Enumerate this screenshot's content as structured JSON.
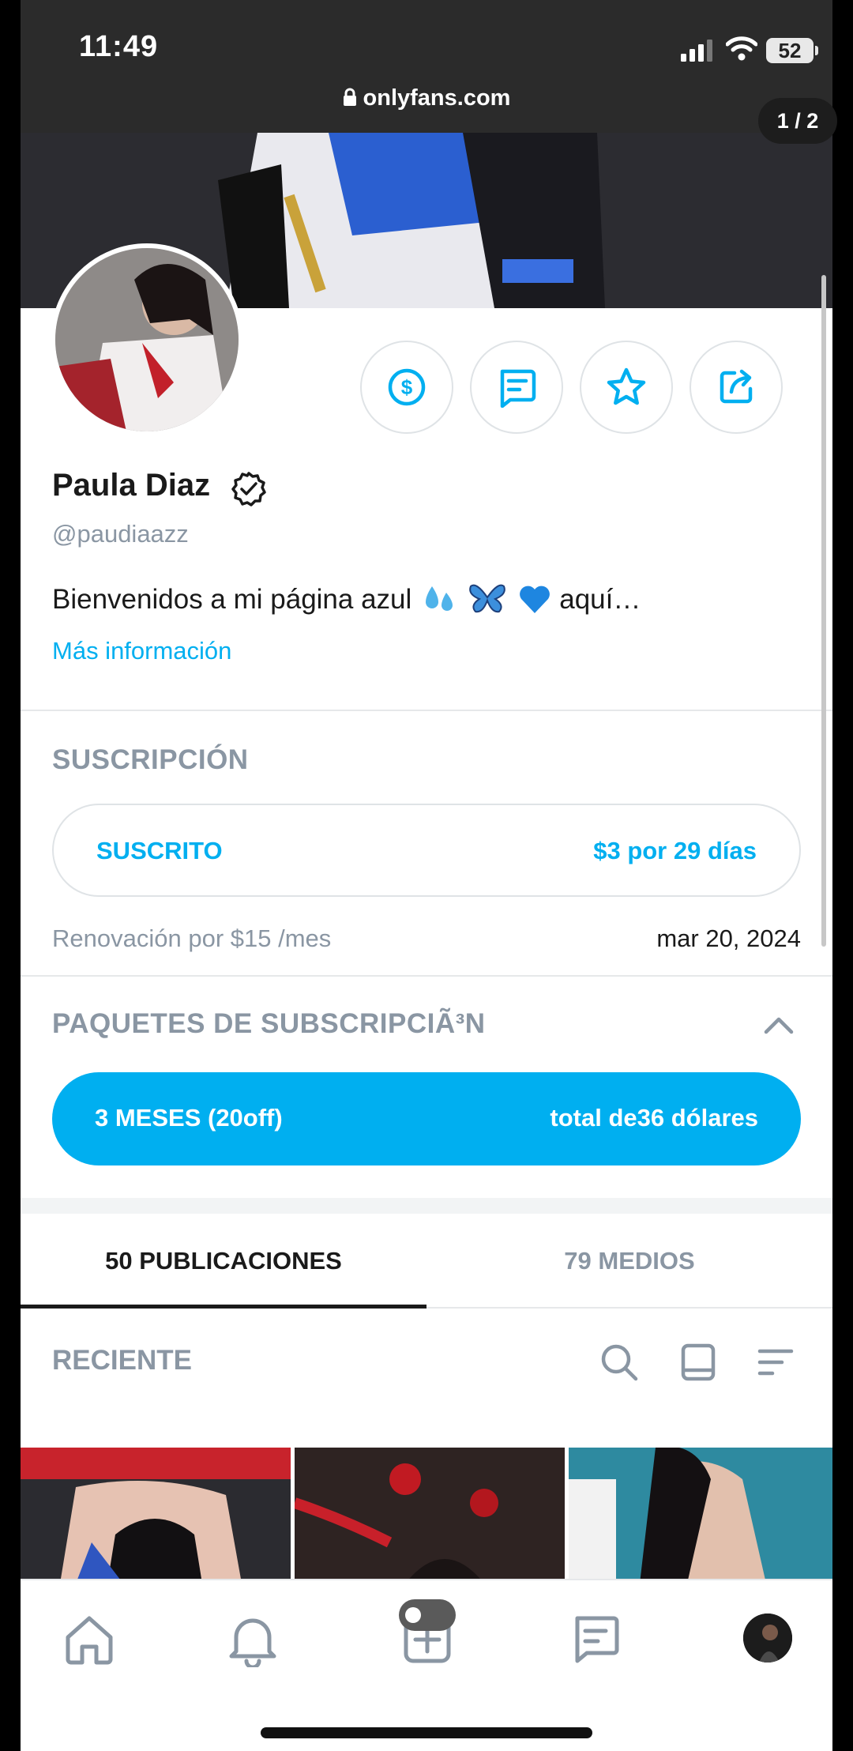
{
  "status_bar": {
    "time": "11:49",
    "battery": "52"
  },
  "browser": {
    "url": "onlyfans.com",
    "page_counter": "1 / 2"
  },
  "profile": {
    "name": "Paula Diaz",
    "handle": "@paudiaazz",
    "bio": "Bienvenidos a mi página azul",
    "bio_tail": "aquí…",
    "more_info": "Más información",
    "actions": [
      "dollar-icon",
      "message-icon",
      "star-icon",
      "share-icon"
    ]
  },
  "subscription": {
    "heading": "SUSCRIPCIÓN",
    "status": "SUSCRITO",
    "price": "$3 por 29 días",
    "renewal": "Renovación por $15 /mes",
    "renewal_date": "mar 20, 2024"
  },
  "bundles": {
    "heading": "PAQUETES DE SUBSCRIPCIÃ³N",
    "label": "3 MESES (20off)",
    "price": "total de36 dólares"
  },
  "tabs": {
    "posts": "50 PUBLICACIONES",
    "media": "79 MEDIOS"
  },
  "feed": {
    "sort_label": "RECIENTE"
  },
  "colors": {
    "accent": "#00aff0",
    "muted": "#8a96a3",
    "text": "#1a1a1a"
  },
  "bottom_nav": [
    "home-icon",
    "bell-icon",
    "add-icon",
    "messages-icon",
    "avatar"
  ]
}
